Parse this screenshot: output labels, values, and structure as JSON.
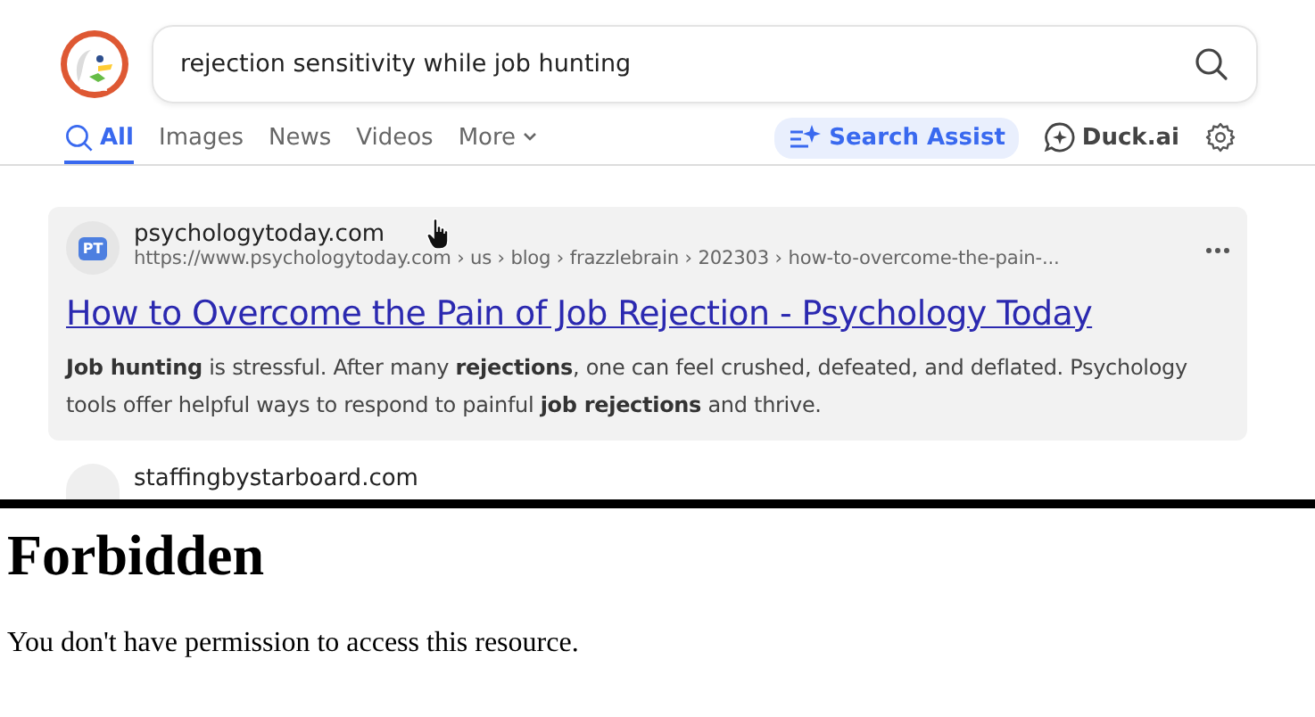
{
  "search": {
    "value": "rejection sensitivity while job hunting"
  },
  "tabs": [
    {
      "label": "All",
      "selected": true,
      "kind": "search"
    },
    {
      "label": "Images",
      "selected": false,
      "kind": "plain"
    },
    {
      "label": "News",
      "selected": false,
      "kind": "plain"
    },
    {
      "label": "Videos",
      "selected": false,
      "kind": "plain"
    },
    {
      "label": "More",
      "selected": false,
      "kind": "dropdown"
    }
  ],
  "assist": {
    "label": "Search Assist"
  },
  "duck_ai": {
    "label": "Duck.ai"
  },
  "results": [
    {
      "domain": "psychologytoday.com",
      "favicon": "PT",
      "url": "https://www.psychologytoday.com › us › blog › frazzlebrain › 202303 › how-to-overcome-the-pain-...",
      "title": "How to Overcome the Pain of Job Rejection - Psychology Today",
      "snippet": "**Job hunting** is stressful. After many **rejections**, one can feel crushed, defeated, and deflated. Psychology tools offer helpful ways to respond to painful **job rejections** and thrive.",
      "hovered": true
    },
    {
      "domain": "staffingbystarboard.com",
      "hovered": false
    }
  ],
  "error": {
    "heading": "Forbidden",
    "message": "You don't have permission to access this resource."
  }
}
